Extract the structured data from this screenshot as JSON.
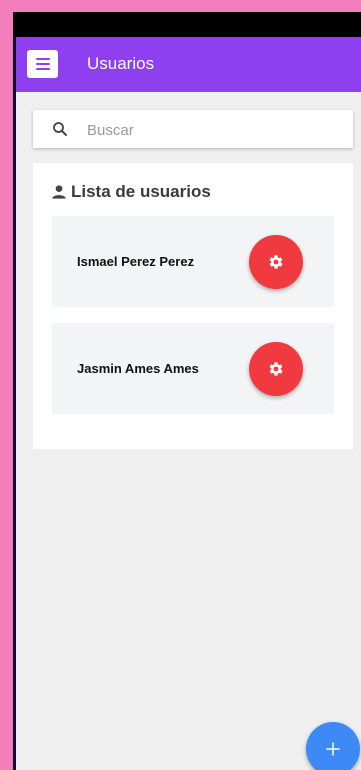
{
  "appbar": {
    "title": "Usuarios",
    "menu_icon": "menu-icon",
    "color": "#8e3ff0"
  },
  "search": {
    "placeholder": "Buscar",
    "value": "",
    "icon": "search-icon"
  },
  "user_list": {
    "title": "Lista de usuarios",
    "title_icon": "person-icon",
    "users": [
      {
        "name": "Ismael Perez Perez",
        "action_icon": "gear-icon"
      },
      {
        "name": "Jasmin Ames Ames",
        "action_icon": "gear-icon"
      }
    ],
    "action_color": "#f03a3f"
  },
  "fab": {
    "icon": "plus-icon",
    "color": "#3d8af7"
  }
}
